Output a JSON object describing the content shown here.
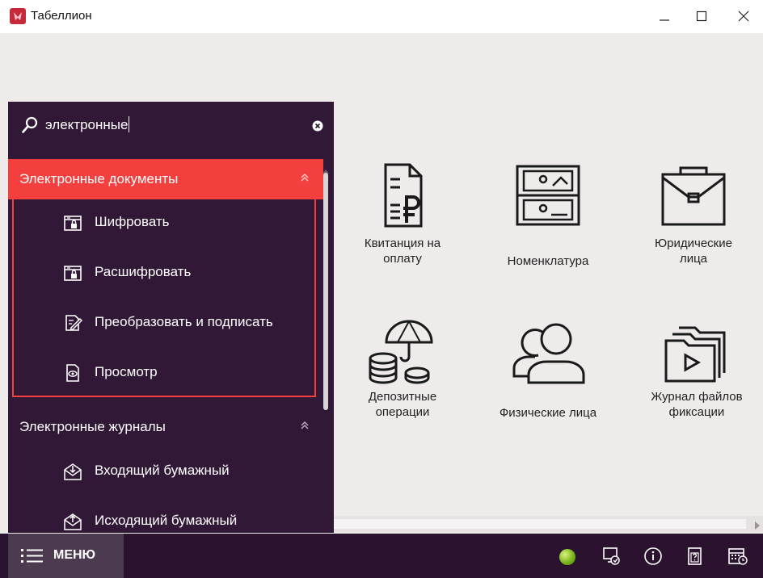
{
  "window": {
    "title": "Табеллион"
  },
  "search": {
    "query": "электронные"
  },
  "sidebar": {
    "groups": [
      {
        "label": "Электронные документы",
        "items": [
          {
            "label": "Шифровать",
            "icon": "lock-folder-icon"
          },
          {
            "label": "Расшифровать",
            "icon": "lock-folder-icon"
          },
          {
            "label": "Преобразовать и подписать",
            "icon": "sign-document-icon"
          },
          {
            "label": "Просмотр",
            "icon": "view-document-icon"
          }
        ]
      },
      {
        "label": "Электронные журналы",
        "items": [
          {
            "label": "Входящий бумажный",
            "icon": "incoming-envelope-icon"
          },
          {
            "label": "Исходящий бумажный",
            "icon": "outgoing-envelope-icon"
          }
        ]
      }
    ]
  },
  "tiles": [
    {
      "label": "Квитанция на\nоплату",
      "icon": "receipt-ruble-icon"
    },
    {
      "label": "Номенклатура",
      "icon": "cabinet-icon"
    },
    {
      "label": "Юридические\nлица",
      "icon": "briefcase-icon"
    },
    {
      "label": "Депозитные\nоперации",
      "icon": "umbrella-coins-icon"
    },
    {
      "label": "Физические лица",
      "icon": "people-icon"
    },
    {
      "label": "Журнал файлов\nфиксации",
      "icon": "video-folder-icon"
    }
  ],
  "bottombar": {
    "menu_label": "МЕНЮ"
  },
  "colors": {
    "accent": "#f3403e",
    "sidebar_bg": "#301836",
    "bottombar_bg": "#2b1330",
    "status_ok": "#7ab51d"
  }
}
